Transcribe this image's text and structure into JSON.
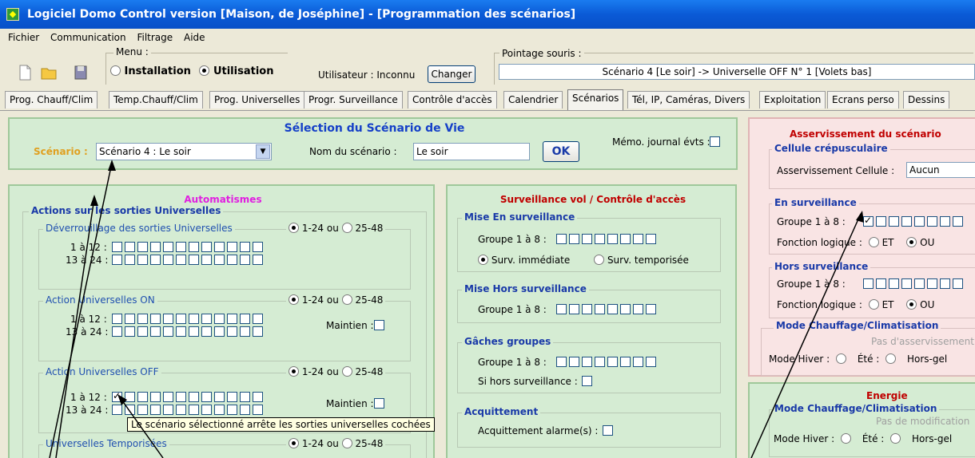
{
  "window": {
    "title": "Logiciel Domo Control version  [Maison, de Joséphine] - [Programmation des scénarios]"
  },
  "menu": [
    "Fichier",
    "Communication",
    "Filtrage",
    "Aide"
  ],
  "toolbar": {
    "menu_label": "Menu :",
    "installation": "Installation",
    "utilisation": "Utilisation",
    "user_label": "Utilisateur : Inconnu",
    "change_btn": "Changer",
    "pointage_label": "Pointage souris :",
    "pointage_value": "Scénario 4 [Le soir] -> Universelle OFF N° 1 [Volets bas]"
  },
  "tabs": [
    "Prog. Chauff/Clim",
    "Temp.Chauff/Clim",
    "Prog. Universelles",
    "Progr. Surveillance",
    "Contrôle d'accès",
    "Calendrier",
    "Scénarios",
    "Tél, IP, Caméras, Divers",
    "Exploitation",
    "Ecrans perso",
    "Dessins"
  ],
  "selection": {
    "title": "Sélection du Scénario de Vie",
    "scenario_label": "Scénario :",
    "scenario_value": "Scénario 4 : Le soir",
    "name_label": "Nom du scénario :",
    "name_value": "Le soir",
    "ok": "OK",
    "memo_label": "Mémo. journal évts :"
  },
  "auto": {
    "title": "Automatismes",
    "actions_title": "Actions sur les sorties Universelles",
    "deverrouillage": "Déverrouillage des sorties Universelles",
    "action_on": "Action Universelles ON",
    "action_off": "Action Universelles OFF",
    "temporisees": "Universelles Temporisées",
    "range1": "1-24 ou",
    "range2": "25-48",
    "row1": "1 à 12 :",
    "row2": "13 à 24 :",
    "maintien": "Maintien :",
    "tooltip": "Le scénario sélectionné arrête les sorties universelles cochées"
  },
  "surv": {
    "title": "Surveillance vol / Contrôle d'accès",
    "mise_en": "Mise En surveillance",
    "groupe": "Groupe 1 à 8 :",
    "surv_imm": "Surv. immédiate",
    "surv_temp": "Surv. temporisée",
    "mise_hors": "Mise Hors surveillance",
    "gaches": "Gâches groupes",
    "si_hors": "Si hors surveillance :",
    "acquittement": "Acquittement",
    "acq_label": "Acquittement alarme(s) :"
  },
  "asserv": {
    "title": "Asservissement du scénario",
    "cellule": "Cellule crépusculaire",
    "asserv_cellule": "Asservissement Cellule :",
    "asserv_value": "Aucun",
    "en_surv": "En surveillance",
    "groupe": "Groupe 1 à 8 :",
    "fonction": "Fonction logique :",
    "et": "ET",
    "ou": "OU",
    "hors_surv": "Hors surveillance",
    "mode_title": "Mode Chauffage/Climatisation",
    "pas_asserv": "Pas d'asservissement",
    "mode_hiver": "Mode Hiver :",
    "ete": "Été :",
    "hors_gel": "Hors-gel"
  },
  "energie": {
    "title": "Energie",
    "mode_title": "Mode Chauffage/Climatisation",
    "pas_modif": "Pas de modification",
    "mode_hiver": "Mode Hiver :",
    "ete": "Été :",
    "hors_gel": "Hors-gel"
  }
}
